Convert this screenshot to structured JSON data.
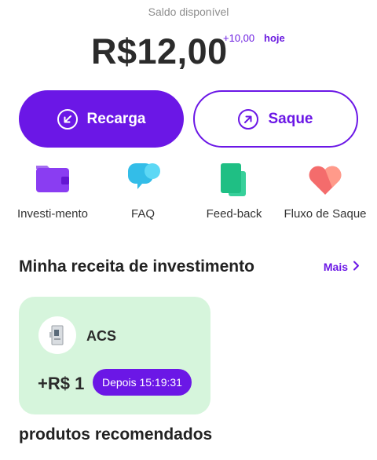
{
  "balance": {
    "label": "Saldo disponível",
    "amount": "R$12,00",
    "delta": "+10,00",
    "delta_period": "hoje"
  },
  "actions": {
    "recharge_label": "Recarga",
    "withdraw_label": "Saque"
  },
  "quick_links": [
    {
      "label": "Investi-mento",
      "icon": "wallet-icon"
    },
    {
      "label": "FAQ",
      "icon": "chat-bubbles-icon"
    },
    {
      "label": "Feed-back",
      "icon": "documents-icon"
    },
    {
      "label": "Fluxo de Saque",
      "icon": "heart-icon"
    }
  ],
  "investment_section": {
    "title": "Minha receita de investimento",
    "more_label": "Mais"
  },
  "investment_card": {
    "name": "ACS",
    "gain": "+R$ 1",
    "timer": "Depois 15:19:31"
  },
  "recommended": {
    "title": "produtos recomendados"
  },
  "colors": {
    "accent": "#6b17e6",
    "card_bg": "#d6f5dc"
  }
}
